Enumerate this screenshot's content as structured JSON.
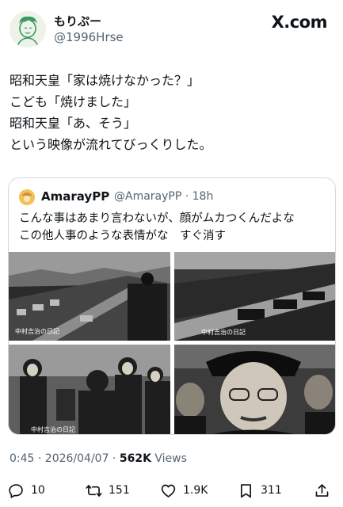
{
  "author": {
    "name": "もりぷー",
    "handle": "@1996Hrse"
  },
  "brand": "X.com",
  "tweet": {
    "lines": [
      "昭和天皇「家は焼けなかった？」",
      "こども「焼けました」",
      "昭和天皇「あ、そう」",
      "という映像が流れてびっくりした。"
    ]
  },
  "quote": {
    "name": "AmarayPP",
    "meta": "@AmarayPP · 18h",
    "lines": [
      "こんな事はあまり言わないが、顔がムカつくんだよな",
      "この他人事のような表情がな　すぐ消す"
    ],
    "media_captions": [
      "中村吉治の日記",
      "中村吉治の日記",
      "中村吉治の日記",
      ""
    ]
  },
  "timestamp": "0:45 · 2026/04/07 · ",
  "views_count": "562K",
  "views_label": " Views",
  "actions": {
    "replies": "10",
    "reposts": "151",
    "likes": "1.9K",
    "bookmarks": "311"
  }
}
